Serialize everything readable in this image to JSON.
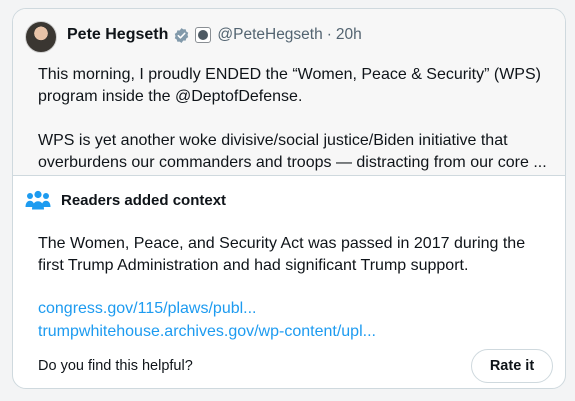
{
  "tweet": {
    "author_name": "Pete Hegseth",
    "handle": "@PeteHegseth",
    "separator": "·",
    "time": "20h",
    "paragraphs": [
      "This morning, I proudly ENDED the “Women, Peace & Security” (WPS) program inside the @DeptofDefense.",
      "WPS is yet another woke divisive/social justice/Biden initiative that overburdens our commanders and troops — distracting from our core ..."
    ]
  },
  "context": {
    "title": "Readers added context",
    "text": "The Women, Peace, and Security Act was passed in 2017 during the first Trump Administration and had significant Trump support.",
    "links": [
      "congress.gov/115/plaws/publ...",
      "trumpwhitehouse.archives.gov/wp-content/upl..."
    ],
    "question": "Do you find this helpful?",
    "rate_label": "Rate it"
  },
  "icons": {
    "verified": "verified-badge-icon",
    "affiliation": "government-seal-icon",
    "readers": "people-icon"
  },
  "colors": {
    "accent": "#1d9bf0",
    "text": "#0f1419",
    "secondary": "#536471",
    "border": "#cfd9de"
  }
}
